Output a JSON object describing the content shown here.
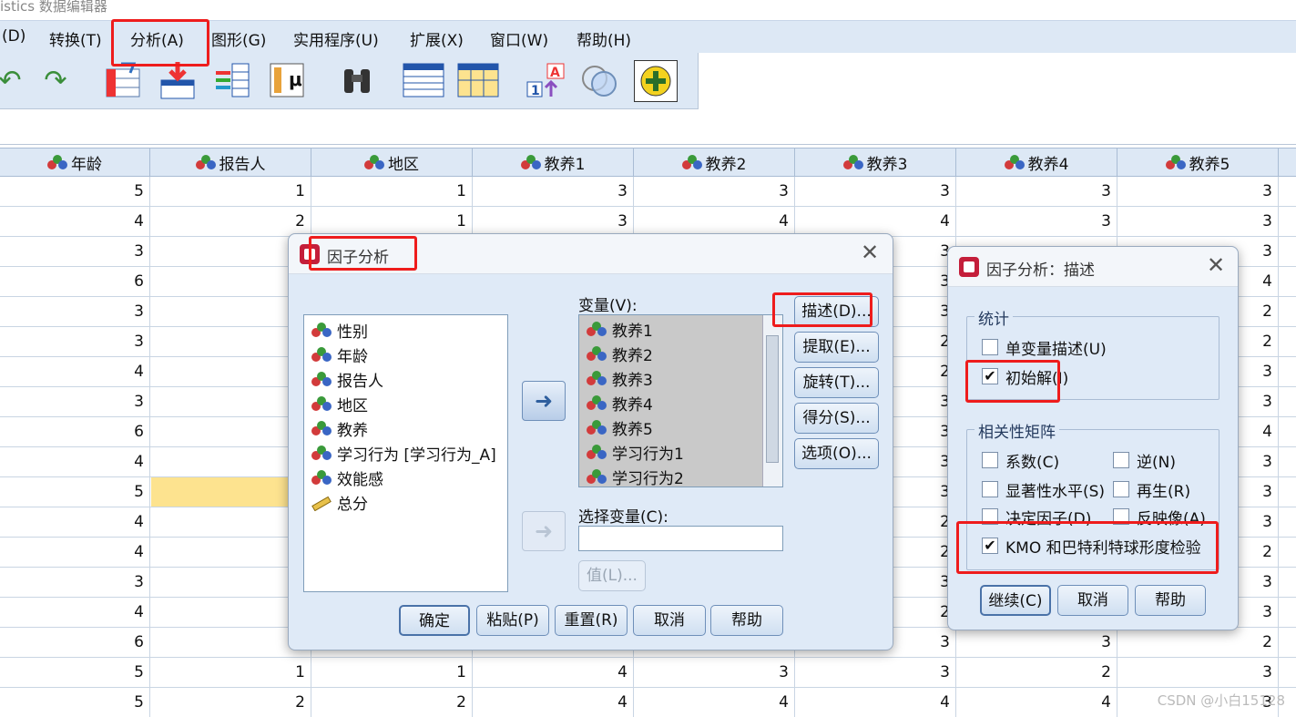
{
  "window": {
    "title": "istics 数据编辑器"
  },
  "menu": {
    "items": [
      "(D)",
      "转换(T)",
      "分析(A)",
      "图形(G)",
      "实用程序(U)",
      "扩展(X)",
      "窗口(W)",
      "帮助(H)"
    ]
  },
  "toolbar": {
    "icons": [
      "undo-icon",
      "redo-icon",
      "goto-case-icon",
      "goto-variable-icon",
      "variables-icon",
      "value-labels-icon",
      "find-icon",
      "insert-cases-icon",
      "split-file-icon",
      "weight-cases-icon",
      "select-cases-icon",
      "use-sets-icon"
    ]
  },
  "grid": {
    "columns": [
      "年龄",
      "报告人",
      "地区",
      "教养1",
      "教养2",
      "教养3",
      "教养4",
      "教养5"
    ],
    "rows": [
      [
        "5",
        "1",
        "1",
        "3",
        "3",
        "3",
        "3",
        "3"
      ],
      [
        "4",
        "2",
        "1",
        "3",
        "4",
        "4",
        "3",
        "3"
      ],
      [
        "3",
        "",
        "",
        "",
        "",
        "3",
        "",
        "3"
      ],
      [
        "6",
        "",
        "",
        "",
        "",
        "3",
        "",
        "4"
      ],
      [
        "3",
        "",
        "",
        "",
        "",
        "3",
        "",
        "2"
      ],
      [
        "3",
        "",
        "",
        "",
        "",
        "2",
        "",
        "2"
      ],
      [
        "4",
        "",
        "",
        "",
        "",
        "2",
        "",
        "3"
      ],
      [
        "3",
        "",
        "",
        "",
        "",
        "3",
        "",
        "3"
      ],
      [
        "6",
        "",
        "",
        "",
        "",
        "3",
        "",
        "4"
      ],
      [
        "4",
        "",
        "",
        "",
        "",
        "3",
        "",
        "3"
      ],
      [
        "5",
        "",
        "",
        "",
        "",
        "3",
        "",
        "3"
      ],
      [
        "4",
        "",
        "",
        "",
        "",
        "2",
        "",
        "3"
      ],
      [
        "4",
        "",
        "",
        "",
        "",
        "2",
        "",
        "2"
      ],
      [
        "3",
        "",
        "",
        "",
        "",
        "3",
        "",
        "3"
      ],
      [
        "4",
        "",
        "",
        "",
        "",
        "2",
        "",
        "3"
      ],
      [
        "6",
        "",
        "",
        "",
        "",
        "3",
        "3",
        "2"
      ],
      [
        "5",
        "1",
        "1",
        "4",
        "3",
        "3",
        "2",
        "3"
      ],
      [
        "5",
        "2",
        "2",
        "4",
        "4",
        "4",
        "4",
        "3"
      ]
    ]
  },
  "factor_dialog": {
    "title": "因子分析",
    "source_list": [
      "性别",
      "年龄",
      "报告人",
      "地区",
      "教养",
      "学习行为 [学习行为_A]",
      "效能感",
      "总分"
    ],
    "variables_label": "变量(V):",
    "variables_list": [
      "教养1",
      "教养2",
      "教养3",
      "教养4",
      "教养5",
      "学习行为1",
      "学习行为2"
    ],
    "selection_label": "选择变量(C):",
    "value_button": "值(L)...",
    "side_buttons": [
      "描述(D)...",
      "提取(E)...",
      "旋转(T)...",
      "得分(S)...",
      "选项(O)..."
    ],
    "bottom_buttons": [
      "确定",
      "粘贴(P)",
      "重置(R)",
      "取消",
      "帮助"
    ]
  },
  "desc_dialog": {
    "title": "因子分析：描述",
    "stats_group": "统计",
    "stats_items": [
      {
        "label": "单变量描述(U)",
        "checked": false
      },
      {
        "label": "初始解(I)",
        "checked": true
      }
    ],
    "corr_group": "相关性矩阵",
    "corr_items": [
      {
        "label": "系数(C)",
        "checked": false
      },
      {
        "label": "逆(N)",
        "checked": false
      },
      {
        "label": "显著性水平(S)",
        "checked": false
      },
      {
        "label": "再生(R)",
        "checked": false
      },
      {
        "label": "决定因子(D)",
        "checked": false
      },
      {
        "label": "反映像(A)",
        "checked": false
      },
      {
        "label": "KMO 和巴特利特球形度检验",
        "checked": true
      }
    ],
    "buttons": [
      "继续(C)",
      "取消",
      "帮助"
    ]
  },
  "watermark": "CSDN @小白15128",
  "colors": {
    "highlight": "#ee1c1c",
    "menubar": "#dde8f5",
    "dialog": "#dfeaf7",
    "selected_cell": "#fde38f"
  }
}
